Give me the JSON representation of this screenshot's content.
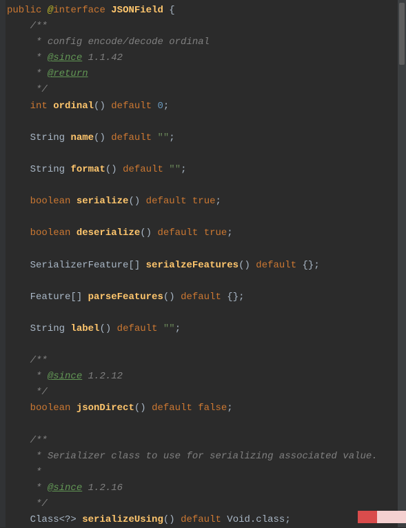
{
  "code": {
    "l1": {
      "kw1": "public",
      "at": "@",
      "kw2": "interface",
      "name": "JSONField",
      "open": "{"
    },
    "l2": "/**",
    "l3": {
      "pre": " * ",
      "text": "config encode/decode ordinal"
    },
    "l4": {
      "pre": " * ",
      "tag": "@since",
      "ver": " 1.1.42"
    },
    "l5": {
      "pre": " * ",
      "tag": "@return"
    },
    "l6": " */",
    "l7": {
      "t": "int",
      "n": "ordinal",
      "p": "()",
      "d": "default",
      "v": "0",
      "s": ";"
    },
    "l8": {
      "t": "String",
      "n": "name",
      "p": "()",
      "d": "default",
      "v": "\"\"",
      "s": ";"
    },
    "l9": {
      "t": "String",
      "n": "format",
      "p": "()",
      "d": "default",
      "v": "\"\"",
      "s": ";"
    },
    "l10": {
      "t": "boolean",
      "n": "serialize",
      "p": "()",
      "d": "default",
      "v": "true",
      "s": ";"
    },
    "l11": {
      "t": "boolean",
      "n": "deserialize",
      "p": "()",
      "d": "default",
      "v": "true",
      "s": ";"
    },
    "l12": {
      "t": "SerializerFeature[]",
      "n": "serialzeFeatures",
      "p": "()",
      "d": "default",
      "v": "{}",
      "s": ";"
    },
    "l13": {
      "t": "Feature[]",
      "n": "parseFeatures",
      "p": "()",
      "d": "default",
      "v": "{}",
      "s": ";"
    },
    "l14": {
      "t": "String",
      "n": "label",
      "p": "()",
      "d": "default",
      "v": "\"\"",
      "s": ";"
    },
    "l15": "/**",
    "l16": {
      "pre": " * ",
      "tag": "@since",
      "ver": " 1.2.12"
    },
    "l17": " */",
    "l18": {
      "t": "boolean",
      "n": "jsonDirect",
      "p": "()",
      "d": "default",
      "v": "false",
      "s": ";"
    },
    "l19": "/**",
    "l20": {
      "pre": " * ",
      "text": "Serializer class to use for serializing associated value."
    },
    "l21": " *",
    "l22": {
      "pre": " * ",
      "tag": "@since",
      "ver": " 1.2.16"
    },
    "l23": " */",
    "l24": {
      "t": "Class<?>",
      "n": "serializeUsing",
      "p": "()",
      "d": "default",
      "v": "Void",
      "cls": ".class",
      "s": ";"
    }
  }
}
